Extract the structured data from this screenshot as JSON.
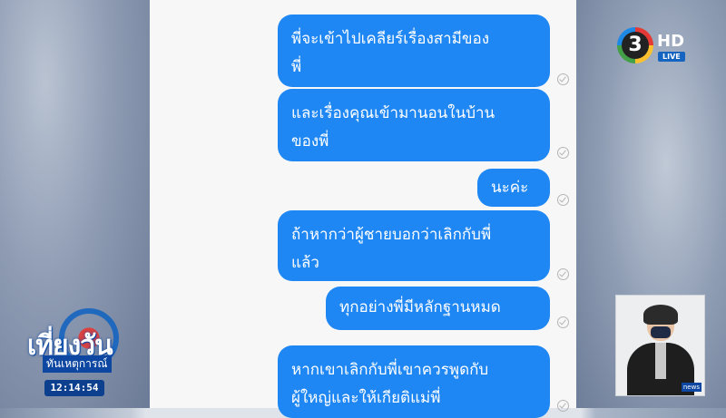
{
  "chat": {
    "messages": [
      {
        "text": "พี่จะเข้าไปเคลียร์เรื่องสามีของ\nพี่"
      },
      {
        "text": "และเรื่องคุณเข้ามานอนในบ้าน\nของพี่"
      },
      {
        "text": "นะค่ะ"
      },
      {
        "text": "ถ้าหากว่าผู้ชายบอกว่าเลิกกับพี่\nแล้ว"
      },
      {
        "text": "ทุกอย่างพี่มีหลักฐานหมด"
      },
      {
        "text": "หากเขาเลิกกับพี่เขาควรพูดกับ\nผู้ใหญ่และให้เกียติแม่พี่"
      }
    ]
  },
  "channel": {
    "number": "3",
    "hd": "HD",
    "live": "LIVE"
  },
  "show": {
    "title": "เที่ยงวัน",
    "subtitle": "ทันเหตุการณ์",
    "clock": "12:14:54"
  },
  "interpreter": {
    "badge": "news"
  },
  "colors": {
    "bubble": "#1f87f3",
    "accent": "#1565c0"
  }
}
